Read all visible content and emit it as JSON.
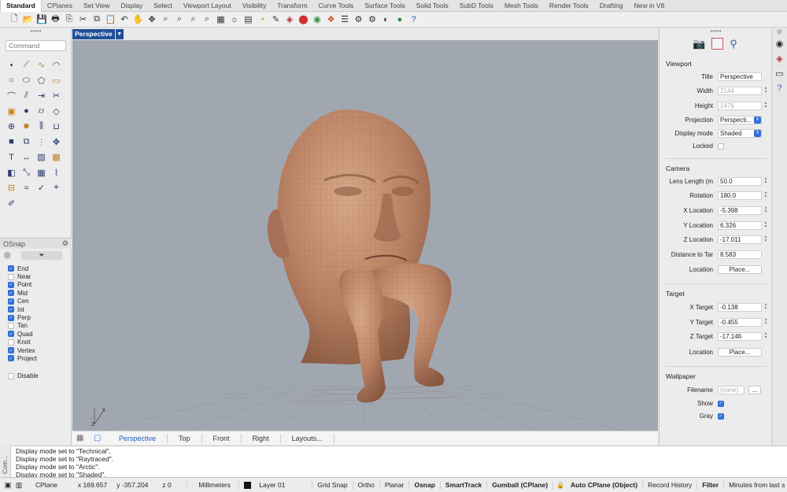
{
  "tabs": [
    "Standard",
    "CPlanes",
    "Set View",
    "Display",
    "Select",
    "Viewport Layout",
    "Visibility",
    "Transform",
    "Curve Tools",
    "Surface Tools",
    "Solid Tools",
    "SubD Tools",
    "Mesh Tools",
    "Render Tools",
    "Drafting",
    "New in V8"
  ],
  "active_tab": "Standard",
  "toolbar_icons": [
    "new-icon",
    "open-icon",
    "save-icon",
    "print-icon",
    "import-icon",
    "cut-icon",
    "copy-icon",
    "paste-icon",
    "undo-icon",
    "pan-icon",
    "rotate-view-icon",
    "zoom-icon",
    "zoom-window-icon",
    "zoom-extents-icon",
    "zoom-selected-icon",
    "grid-layout-icon",
    "sun-icon",
    "named-views-icon",
    "light-icon",
    "properties-icon",
    "materials-icon",
    "color-icon",
    "color-wheel-icon",
    "render-icon",
    "layers-icon",
    "options-icon",
    "gear-icon",
    "shading-icon",
    "sphere-icon",
    "help-icon"
  ],
  "command": {
    "placeholder": "Command"
  },
  "tools_icons": [
    "point-icon",
    "polyline-icon",
    "curve-icon",
    "arc-icon",
    "circle-icon",
    "ellipse-icon",
    "polygon-icon",
    "rectangle-icon",
    "fillet-icon",
    "offset-icon",
    "extend-icon",
    "trim-icon",
    "box-icon",
    "sphere-icon",
    "cylinder-icon",
    "surface-icon",
    "boolean-icon",
    "explode-icon",
    "split-icon",
    "join-icon",
    "solid-icon",
    "group-icon",
    "array-icon",
    "move-icon",
    "text-icon",
    "dimension-icon",
    "hatch-icon",
    "block-icon",
    "cube-icon",
    "scale-icon",
    "grid-snap-icon",
    "pipe-icon",
    "section-icon",
    "flow-icon",
    "check-icon",
    "analyze-icon",
    "paint-icon"
  ],
  "osnap": {
    "title": "OSnap",
    "items": [
      {
        "label": "End",
        "on": true
      },
      {
        "label": "Near",
        "on": false
      },
      {
        "label": "Point",
        "on": true
      },
      {
        "label": "Mid",
        "on": true
      },
      {
        "label": "Cen",
        "on": true
      },
      {
        "label": "Int",
        "on": true
      },
      {
        "label": "Perp",
        "on": true
      },
      {
        "label": "Tan",
        "on": false
      },
      {
        "label": "Quad",
        "on": true
      },
      {
        "label": "Knot",
        "on": false
      },
      {
        "label": "Vertex",
        "on": true
      },
      {
        "label": "Project",
        "on": true
      }
    ],
    "disable_label": "Disable"
  },
  "viewport": {
    "title": "Perspective",
    "axis_x": "x",
    "axis_z": "z"
  },
  "viewport_tabs": [
    "Perspective",
    "Top",
    "Front",
    "Right",
    "Layouts..."
  ],
  "properties": {
    "viewport_section": "Viewport",
    "title_label": "Title",
    "title_value": "Perspective",
    "width_label": "Width",
    "width_value": "2144",
    "height_label": "Height",
    "height_value": "1476",
    "projection_label": "Projection",
    "projection_value": "Perspecti...",
    "display_mode_label": "Display mode",
    "display_mode_value": "Shaded",
    "locked_label": "Locked",
    "camera_section": "Camera",
    "lens_label": "Lens Length (m",
    "lens_value": "50.0",
    "rotation_label": "Rotation",
    "rotation_value": "180.0",
    "xloc_label": "X Location",
    "xloc_value": "-5.398",
    "yloc_label": "Y Location",
    "yloc_value": "6.326",
    "zloc_label": "Z Location",
    "zloc_value": "-17.011",
    "dist_label": "Distance to Tar",
    "dist_value": "8.583",
    "location_label": "Location",
    "place_label": "Place...",
    "target_section": "Target",
    "xtarget_label": "X Target",
    "xtarget_value": "-0.138",
    "ytarget_label": "Y Target",
    "ytarget_value": "-0.455",
    "ztarget_label": "Z Target",
    "ztarget_value": "-17.146",
    "tlocation_label": "Location",
    "tplace_label": "Place...",
    "wallpaper_section": "Wallpaper",
    "filename_label": "Filename",
    "filename_value": "(none)",
    "browse_label": "...",
    "show_label": "Show",
    "gray_label": "Gray"
  },
  "history": {
    "side_label": "Com...",
    "lines": [
      "Display mode set to \"Technical\".",
      "Display mode set to \"Raytraced\".",
      "Display mode set to \"Arctic\".",
      "Display mode set to \"Shaded\"."
    ]
  },
  "status": {
    "cplane": "CPlane",
    "x": "x 169.657",
    "y": "y -357.204",
    "z": "z 0",
    "units": "Millimeters",
    "layer": "Layer 01",
    "grid_snap": "Grid Snap",
    "ortho": "Ortho",
    "planar": "Planar",
    "osnap": "Osnap",
    "smarttrack": "SmartTrack",
    "gumball": "Gumball (CPlane)",
    "auto_cplane": "Auto CPlane (Object)",
    "record_history": "Record History",
    "filter": "Filter",
    "minutes": "Minutes from last s"
  }
}
